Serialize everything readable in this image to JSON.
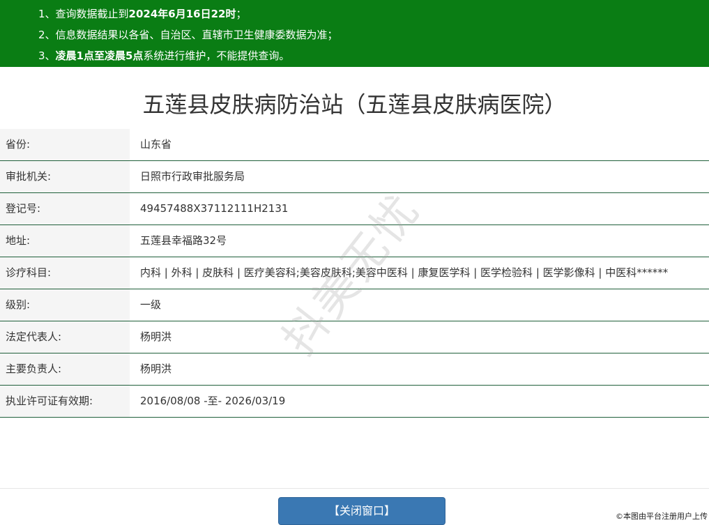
{
  "notice": {
    "line1_prefix": "1、查询数据截止到",
    "line1_bold": "2024年6月16日22时",
    "line1_suffix": "；",
    "line2": "2、信息数据结果以各省、自治区、直辖市卫生健康委数据为准；",
    "line3_prefix": "3、",
    "line3_bold": "凌晨1点至凌晨5点",
    "line3_suffix": "系统进行维护，不能提供查询。"
  },
  "title": "五莲县皮肤病防治站（五莲县皮肤病医院）",
  "rows": [
    {
      "label": "省份:",
      "value": "山东省"
    },
    {
      "label": "审批机关:",
      "value": "日照市行政审批服务局"
    },
    {
      "label": "登记号:",
      "value": "49457488X37112111H2131"
    },
    {
      "label": "地址:",
      "value": "五莲县幸福路32号"
    },
    {
      "label": "诊疗科目:",
      "value": "内科 | 外科 | 皮肤科 | 医疗美容科;美容皮肤科;美容中医科 | 康复医学科 | 医学检验科 | 医学影像科 | 中医科******"
    },
    {
      "label": "级别:",
      "value": "一级"
    },
    {
      "label": "法定代表人:",
      "value": "杨明洪"
    },
    {
      "label": "主要负责人:",
      "value": "杨明洪"
    },
    {
      "label": "执业许可证有效期:",
      "value": "2016/08/08 -至- 2026/03/19"
    }
  ],
  "close_button": "【关闭窗口】",
  "watermark": "抖美无忧",
  "credit": "©本图由平台注册用户上传",
  "colors": {
    "notice_bg": "#0a7d14",
    "button_bg": "#3a78b3",
    "row_border": "#1f5f3a",
    "label_bg": "#f5f5f5"
  }
}
